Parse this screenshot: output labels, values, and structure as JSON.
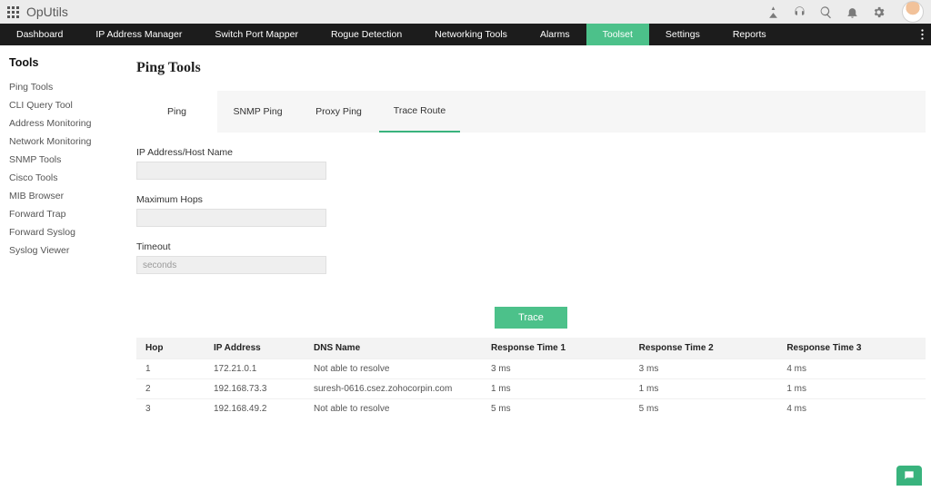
{
  "brand": "OpUtils",
  "nav": {
    "items": [
      "Dashboard",
      "IP Address Manager",
      "Switch Port Mapper",
      "Rogue Detection",
      "Networking Tools",
      "Alarms",
      "Toolset",
      "Settings",
      "Reports"
    ],
    "activeIndex": 6
  },
  "sidebar": {
    "title": "Tools",
    "items": [
      "Ping Tools",
      "CLI Query Tool",
      "Address Monitoring",
      "Network Monitoring",
      "SNMP Tools",
      "Cisco Tools",
      "MIB Browser",
      "Forward Trap",
      "Forward Syslog",
      "Syslog Viewer"
    ]
  },
  "page": {
    "title": "Ping Tools"
  },
  "tabs": {
    "items": [
      "Ping",
      "SNMP Ping",
      "Proxy Ping",
      "Trace Route"
    ],
    "activeIndex": 3
  },
  "form": {
    "ip_label": "IP Address/Host Name",
    "ip_value": "",
    "hops_label": "Maximum Hops",
    "hops_value": "",
    "timeout_label": "Timeout",
    "timeout_placeholder": "seconds",
    "timeout_value": "",
    "submit": "Trace"
  },
  "table": {
    "headers": [
      "Hop",
      "IP Address",
      "DNS Name",
      "Response Time 1",
      "Response Time 2",
      "Response Time 3"
    ],
    "rows": [
      [
        "1",
        "172.21.0.1",
        "Not able to resolve",
        "3 ms",
        "3 ms",
        "4 ms"
      ],
      [
        "2",
        "192.168.73.3",
        "suresh-0616.csez.zohocorpin.com",
        "1 ms",
        "1 ms",
        "1 ms"
      ],
      [
        "3",
        "192.168.49.2",
        "Not able to resolve",
        "5 ms",
        "5 ms",
        "4 ms"
      ]
    ]
  }
}
